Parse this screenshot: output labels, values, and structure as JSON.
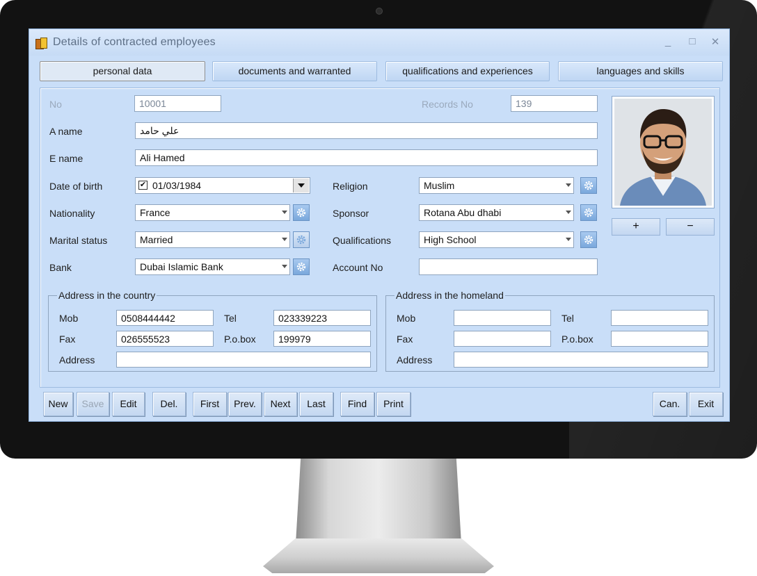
{
  "window": {
    "title": "Details of contracted employees",
    "controls": {
      "minimize": "_",
      "maximize": "□",
      "close": "✕"
    }
  },
  "tabs": [
    {
      "label": "personal data",
      "active": true
    },
    {
      "label": "documents and warranted",
      "active": false
    },
    {
      "label": "qualifications and experiences",
      "active": false
    },
    {
      "label": "languages and skills",
      "active": false
    }
  ],
  "form": {
    "no": {
      "label": "No",
      "value": "10001"
    },
    "records_no": {
      "label": "Records No",
      "value": "139"
    },
    "a_name": {
      "label": "A name",
      "value": "علي حامد"
    },
    "e_name": {
      "label": "E name",
      "value": "Ali Hamed"
    },
    "date_of_birth": {
      "label": "Date of birth",
      "value": "01/03/1984",
      "checked": true
    },
    "nationality": {
      "label": "Nationality",
      "value": "France"
    },
    "marital_status": {
      "label": "Marital status",
      "value": "Married"
    },
    "bank": {
      "label": "Bank",
      "value": "Dubai Islamic Bank"
    },
    "religion": {
      "label": "Religion",
      "value": "Muslim"
    },
    "sponsor": {
      "label": "Sponsor",
      "value": "Rotana Abu dhabi"
    },
    "qualifications": {
      "label": "Qualifications",
      "value": "High School"
    },
    "account_no": {
      "label": "Account No",
      "value": ""
    }
  },
  "address_country": {
    "title": "Address in the country",
    "mob": {
      "label": "Mob",
      "value": "0508444442"
    },
    "tel": {
      "label": "Tel",
      "value": "023339223"
    },
    "fax": {
      "label": "Fax",
      "value": "026555523"
    },
    "pobox": {
      "label": "P.o.box",
      "value": "199979"
    },
    "address": {
      "label": "Address",
      "value": ""
    }
  },
  "address_homeland": {
    "title": "Address in the homeland",
    "mob": {
      "label": "Mob",
      "value": ""
    },
    "tel": {
      "label": "Tel",
      "value": ""
    },
    "fax": {
      "label": "Fax",
      "value": ""
    },
    "pobox": {
      "label": "P.o.box",
      "value": ""
    },
    "address": {
      "label": "Address",
      "value": ""
    }
  },
  "photo": {
    "add_label": "+",
    "remove_label": "−"
  },
  "toolbar": {
    "new": "New",
    "save": "Save",
    "edit": "Edit",
    "del": "Del.",
    "first": "First",
    "prev": "Prev.",
    "next": "Next",
    "last": "Last",
    "find": "Find",
    "print": "Print",
    "cancel": "Can.",
    "exit": "Exit"
  },
  "colors": {
    "window_bg": "#c9def8",
    "accent": "#7aa8dc",
    "disabled_text": "#9aa6b5"
  }
}
